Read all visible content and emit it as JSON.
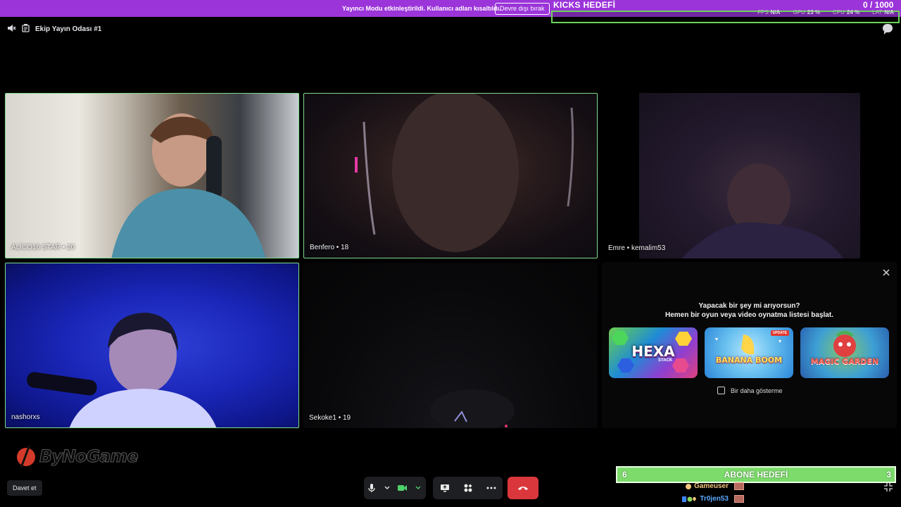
{
  "banner": {
    "text": "Yayıncı Modu etkinleştirildi. Kullanıcı adları kısaltıldı.",
    "button_label": "Devre dışı bırak"
  },
  "kicks_goal": {
    "label": "KICKS HEDEFİ",
    "count": "0   / 1000",
    "progress": 0
  },
  "stats": [
    {
      "label": "FPS",
      "value": "N/A"
    },
    {
      "label": "GPU",
      "value": "23 %"
    },
    {
      "label": "CPU",
      "value": "24 %"
    },
    {
      "label": "LAT",
      "value": "N/A"
    }
  ],
  "channel": {
    "title": "Ekip Yayın Odası #1"
  },
  "tiles": [
    {
      "name": "ALİCO16 STAR • 20",
      "speaking": true
    },
    {
      "name": "Benfero • 18",
      "speaking": true
    },
    {
      "name": "Emre • kemalim53",
      "speaking": false
    },
    {
      "name": "nashorxs",
      "speaking": true
    },
    {
      "name": "Sekoke1 • 19",
      "speaking": false
    }
  ],
  "activity_panel": {
    "question": "Yapacak bir şey mi arıyorsun?",
    "subtitle": "Hemen bir oyun veya video oynatma listesi başlat.",
    "games": [
      {
        "title": "HEXA",
        "subtitle": "STACK",
        "badge": ""
      },
      {
        "title": "BANANA BOOM",
        "subtitle": "",
        "badge": "UPDATE"
      },
      {
        "title": "MAGIC GARDEN",
        "subtitle": "",
        "badge": ""
      }
    ],
    "dont_show_label": "Bir daha gösterme"
  },
  "watermark": "ByNoGame",
  "controls": {
    "invite_label": "Davet et"
  },
  "sub_goal": {
    "label": "ABONE HEDEFİ",
    "left_value": "6",
    "right_value": "3",
    "progress": 1.0
  },
  "feed": [
    {
      "user": "Gameuser",
      "color": "#f2c57c"
    },
    {
      "user": "Tr0jen53",
      "color": "#5aa9ff"
    }
  ]
}
